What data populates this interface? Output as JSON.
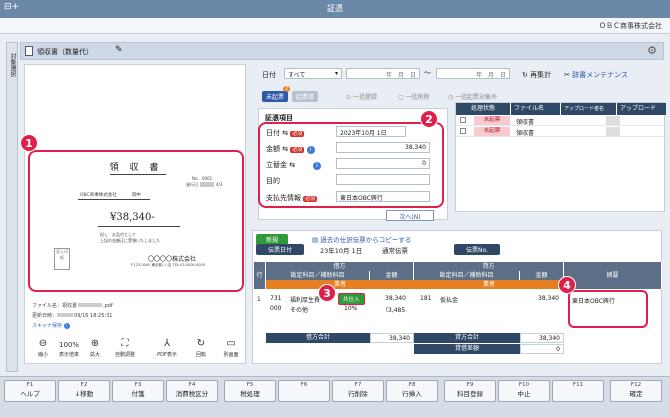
{
  "window": {
    "title": "証憑",
    "company": "ＯＢＣ商事株式会社"
  },
  "side_tab": {
    "label": "対象選択"
  },
  "doc_bar": {
    "name": "領収書（数量代）"
  },
  "receipt": {
    "title": "領 収 書",
    "no_label": "No.",
    "no_value": "0001",
    "date_label": "発行日",
    "date_value": "4/3",
    "addressee": "OBC商事株式会社",
    "honorific": "御中",
    "amount": "¥38,340-",
    "memo1": "但し　お品代として",
    "memo2": "上記の金額正に受領いたしました",
    "stamp_label": "収入印紙",
    "issuer": "〇〇〇〇株式会社",
    "issuer_addr": "〒123-0000 東京都○○区 TEL:03-0000-0000"
  },
  "file_info": {
    "file_name_label": "ファイル名：",
    "file_name": "領収書",
    "file_ext": ".pdf",
    "updated_label": "更新日時：",
    "updated": "09/16 18:25:31",
    "scan_link": "スキャナ保存"
  },
  "preview_toolbar": {
    "shrink": "縮小",
    "zoom_pct": "100%",
    "zoom_label": "表示倍率",
    "enlarge": "拡大",
    "auto_adjust": "自動調整",
    "pdf": "PDF表示",
    "rotate": "回転",
    "separate": "別画面"
  },
  "filters": {
    "date_label": "日付",
    "date_select": "すべて",
    "from_placeholder": "年　月　日",
    "tilde": "〜",
    "to_placeholder": "年　月　日",
    "recount": "再集計",
    "dictionary": "辞書メンテナンス"
  },
  "tabs": {
    "uncreated": "未起票",
    "uncreated_count": "2",
    "created": "起票済"
  },
  "bulk": {
    "register": "一括登録",
    "delete": "一括削除",
    "exclude": "一括起票対象外"
  },
  "form": {
    "section_title": "証憑項目",
    "required_label": "必須",
    "date_label": "日付",
    "date_value": "2023年10月 1日",
    "amount_label": "金額",
    "amount_value": "38,340",
    "advance_label": "立替金",
    "advance_value": "0",
    "purpose_label": "目的",
    "purpose_value": "",
    "payee_label": "支払先情報",
    "payee_value": "東日本OBC興行",
    "next": "次へ(N)"
  },
  "status_grid": {
    "headers": [
      "処理状態",
      "ファイル名",
      "アップロード者名",
      "アップロード"
    ],
    "rows": [
      {
        "status": "未起票",
        "file": "領収書"
      },
      {
        "status": "未起票",
        "file": "領収書"
      }
    ]
  },
  "journal": {
    "mode": "新規",
    "copy_link": "過去の仕訳伝票からコピーする",
    "date_label": "伝票日付",
    "date_value": "23年10月 1日",
    "voucher_type": "通常伝票",
    "voucher_no_label": "伝票No.",
    "row_header": "行",
    "debit": "借方",
    "credit": "貸方",
    "account_header": "勘定科目／補助科目",
    "amount_header": "金額",
    "trader_header": "業者",
    "memo_header": "摘要",
    "row_no": "1",
    "debit_code1": "731",
    "debit_name1": "福利厚生費",
    "debit_tag": "共仕入",
    "debit_code2": "000",
    "debit_name2": "その他",
    "debit_amount": "38,340",
    "debit_tax": "（3,485",
    "debit_rate": "10%",
    "credit_code": "181",
    "credit_name": "仮払金",
    "credit_amount": "38,340",
    "memo": "東日本OBC興行",
    "debit_total_label": "借方合計",
    "debit_total": "38,340",
    "credit_total_label": "貸方合計",
    "credit_total": "38,340",
    "diff_label": "貸借差額",
    "diff": "0"
  },
  "callouts": [
    "1",
    "2",
    "3",
    "4"
  ],
  "fkeys": [
    {
      "n": "F1",
      "l": "ヘルプ"
    },
    {
      "n": "F2",
      "l": "↓移動"
    },
    {
      "n": "F3",
      "l": "付箋"
    },
    {
      "n": "F4",
      "l": "消費税区分"
    },
    {
      "n": "F5",
      "l": "税処理"
    },
    {
      "n": "F6",
      "l": ""
    },
    {
      "n": "F7",
      "l": "行削除"
    },
    {
      "n": "F8",
      "l": "行挿入"
    },
    {
      "n": "F9",
      "l": "科目登録"
    },
    {
      "n": "F10",
      "l": "中止"
    },
    {
      "n": "F11",
      "l": ""
    },
    {
      "n": "F12",
      "l": "確定"
    }
  ],
  "colors": {
    "accent_red": "#e0204c",
    "header_navy": "#2f4866",
    "title_blue": "#6c88a8"
  }
}
